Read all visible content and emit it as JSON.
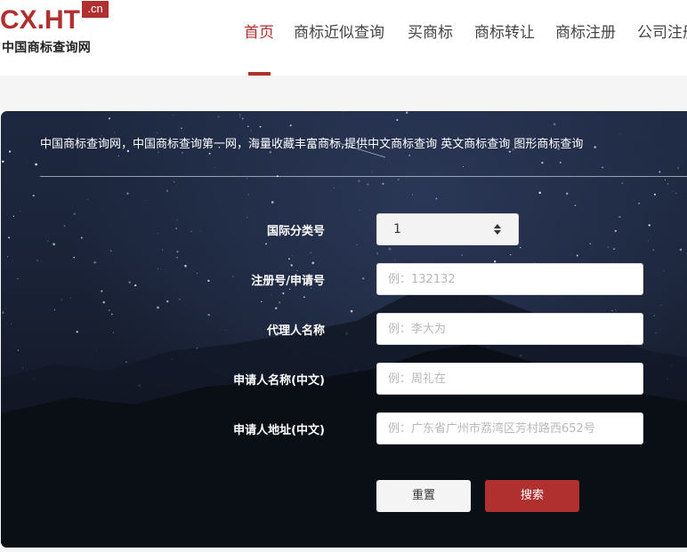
{
  "logo": {
    "main": "CX.HT",
    "badge": ".cn",
    "subtitle": "中国商标查询网"
  },
  "nav": {
    "items": [
      {
        "label": "首页",
        "active": true
      },
      {
        "label": "商标近似查询",
        "active": false
      },
      {
        "label": "买商标",
        "active": false
      },
      {
        "label": "商标转让",
        "active": false
      },
      {
        "label": "商标注册",
        "active": false
      },
      {
        "label": "公司注册",
        "active": false
      }
    ]
  },
  "colors": {
    "accent": "#b0302f"
  },
  "search": {
    "description": "中国商标查询网，中国商标查询第一网，海量收藏丰富商标,提供中文商标查询 英文商标查询 图形商标查询",
    "fields": {
      "class": {
        "label": "国际分类号",
        "value": "1",
        "icon": "updown-arrows-icon"
      },
      "reg_no": {
        "label": "注册号/申请号",
        "placeholder": "例：132132"
      },
      "agent": {
        "label": "代理人名称",
        "placeholder": "例：李大为"
      },
      "applicant": {
        "label": "申请人名称(中文)",
        "placeholder": "例：周礼在"
      },
      "address": {
        "label": "申请人地址(中文)",
        "placeholder": "例：广东省广州市荔湾区芳村路西652号"
      }
    },
    "buttons": {
      "reset": "重置",
      "search": "搜索"
    }
  }
}
